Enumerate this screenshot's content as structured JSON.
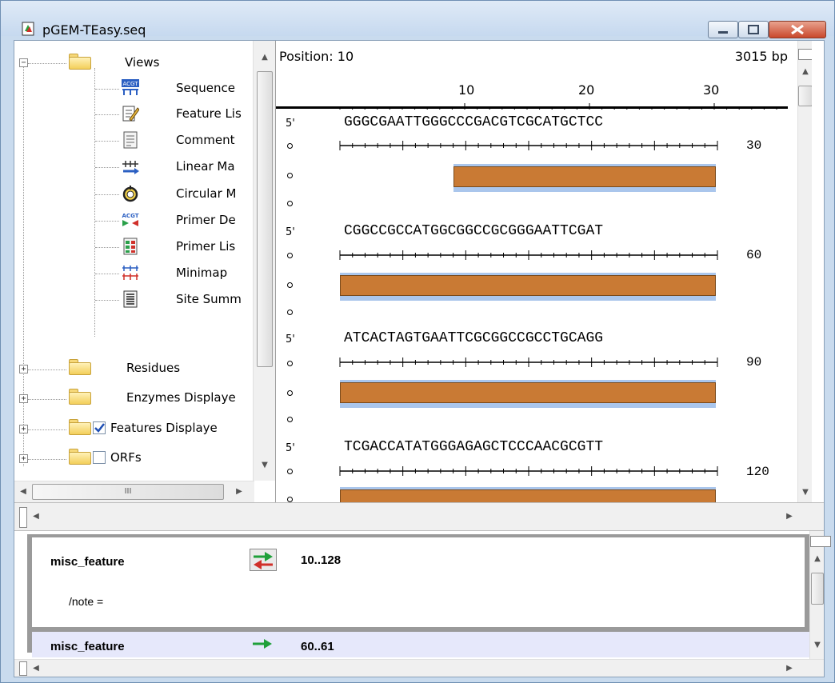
{
  "window": {
    "title": "pGEM-TEasy.seq",
    "buttons": [
      "minimize",
      "maximize",
      "close"
    ]
  },
  "tree": {
    "views_folder": "Views",
    "view_items": [
      {
        "label": "Sequence",
        "icon": "sequence-view-icon"
      },
      {
        "label": "Feature Lis",
        "icon": "feature-list-icon"
      },
      {
        "label": "Comment",
        "icon": "comment-icon"
      },
      {
        "label": "Linear Ma",
        "icon": "linear-map-icon"
      },
      {
        "label": "Circular M",
        "icon": "circular-map-icon"
      },
      {
        "label": "Primer De",
        "icon": "primer-design-icon"
      },
      {
        "label": "Primer Lis",
        "icon": "primer-list-icon"
      },
      {
        "label": "Minimap",
        "icon": "minimap-icon"
      },
      {
        "label": "Site Summ",
        "icon": "site-summary-icon"
      }
    ],
    "folders": [
      {
        "label": "Residues",
        "checkbox": null
      },
      {
        "label": "Enzymes Displaye",
        "checkbox": null
      },
      {
        "label": "Features Displaye",
        "checkbox": true
      },
      {
        "label": "ORFs",
        "checkbox": false
      }
    ],
    "hscroll_grip": "III"
  },
  "sequence": {
    "position_label": "Position: 10",
    "length_label": "3015 bp",
    "ruler_ticks": [
      "10",
      "20",
      "30"
    ],
    "strand_marker": "5'",
    "rows": [
      {
        "seq": "GGGCGAATTGGGCCCGACGTCGCATGCTCC",
        "end": "30"
      },
      {
        "seq": "CGGCCGCCATGGCGGCCGCGGGAATTCGAT",
        "end": "60"
      },
      {
        "seq": "ATCACTAGTGAATTCGCGGCCGCCTGCAGG",
        "end": "90"
      },
      {
        "seq": "TCGACCATATGGGAGAGCTCCCAACGCGTT",
        "end": "120"
      }
    ],
    "feature_color": "#c97a34",
    "feature_halo": "#aac6ec"
  },
  "features": [
    {
      "type": "misc_feature",
      "range": "10..128",
      "qualifier": "/note  ="
    },
    {
      "type": "misc_feature",
      "range": "60..61"
    }
  ]
}
